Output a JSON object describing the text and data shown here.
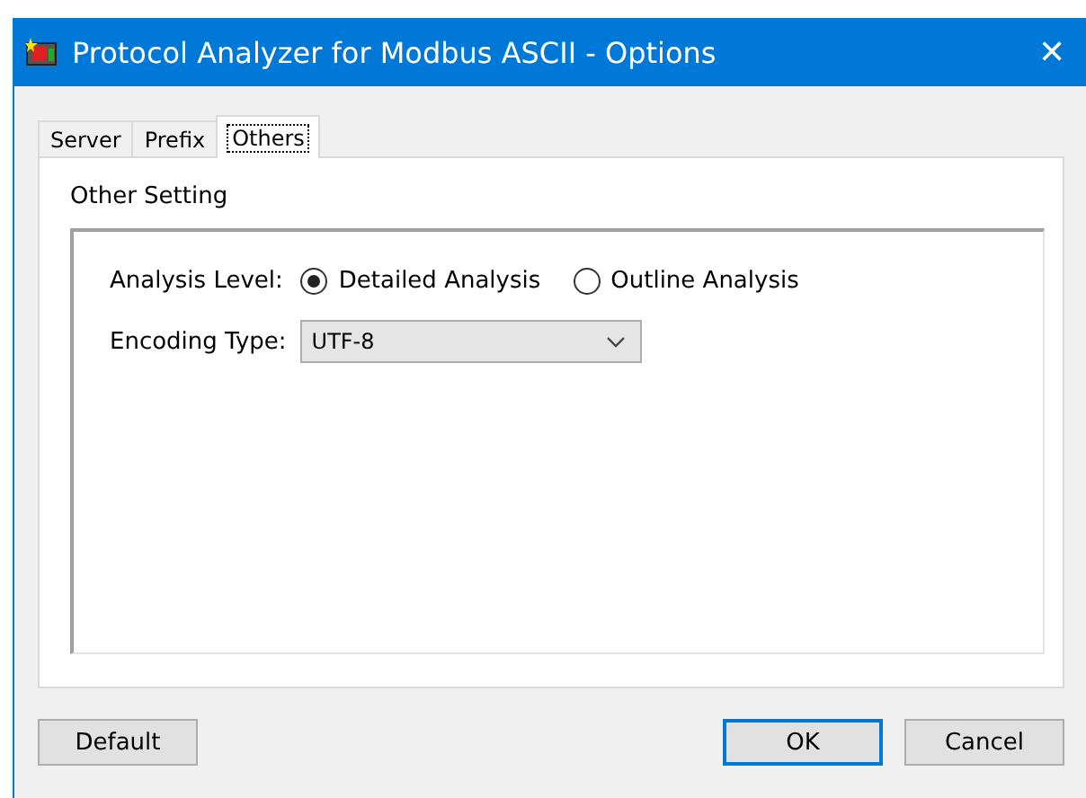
{
  "window": {
    "title": "Protocol Analyzer for Modbus ASCII - Options",
    "close": "✕"
  },
  "tabs": [
    {
      "label": "Server",
      "selected": false
    },
    {
      "label": "Prefix",
      "selected": false
    },
    {
      "label": "Others",
      "selected": true
    }
  ],
  "section_title": "Other Setting",
  "analysis_level": {
    "label": "Analysis Level:",
    "options": [
      {
        "label": "Detailed Analysis",
        "selected": true
      },
      {
        "label": "Outline Analysis",
        "selected": false
      }
    ]
  },
  "encoding_type": {
    "label": "Encoding Type:",
    "value": "UTF-8"
  },
  "buttons": [
    {
      "label": "Default",
      "kind": "plain"
    },
    {
      "label": "OK",
      "kind": "default"
    },
    {
      "label": "Cancel",
      "kind": "plain"
    }
  ]
}
